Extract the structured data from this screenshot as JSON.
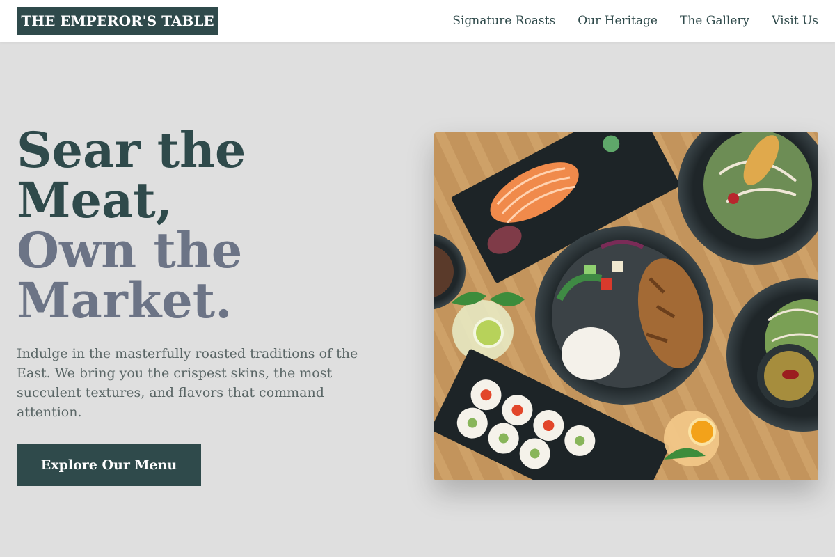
{
  "header": {
    "logo": "THE EMPEROR'S TABLE",
    "nav": [
      {
        "label": "Signature Roasts"
      },
      {
        "label": "Our Heritage"
      },
      {
        "label": "The Gallery"
      },
      {
        "label": "Visit Us"
      }
    ]
  },
  "hero": {
    "headline_line1": "Sear the",
    "headline_line2": "Meat,",
    "headline_line3": "Own the",
    "headline_line4": "Market.",
    "intro": "Indulge in the masterfully roasted traditions of the East. We bring you the crispest skins, the most succulent textures, and flavors that command attention.",
    "cta_label": "Explore Our Menu"
  },
  "colors": {
    "brand": "#2f4a4b",
    "muted_heading": "#6c7486",
    "page_bg": "#dfdfdf"
  }
}
